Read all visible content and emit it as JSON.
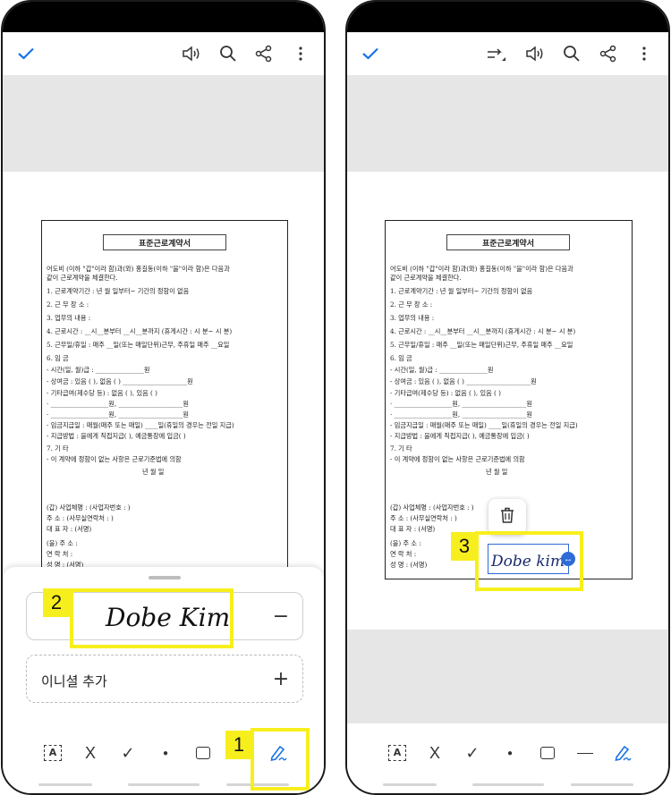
{
  "left_screen": {
    "toolbar": {
      "done_icon": "check-icon",
      "read_aloud_icon": "speaker-icon",
      "search_icon": "search-icon",
      "share_icon": "share-icon",
      "more_icon": "more-vertical-icon"
    },
    "signature_panel": {
      "signature_text": "Dobe Kim",
      "remove_symbol": "−",
      "add_initial_label": "이니셜 추가",
      "add_symbol": "+"
    },
    "bottom_tools": {
      "text_box_glyph": "A",
      "cross_glyph": "X",
      "check_glyph": "✓",
      "dot_glyph": "●",
      "sign_tool_icon": "pen-signature-icon"
    },
    "badges": {
      "one": "1",
      "two": "2"
    }
  },
  "right_screen": {
    "toolbar": {
      "done_icon": "check-icon",
      "reflow_icon": "reflow-icon",
      "read_aloud_icon": "speaker-icon",
      "search_icon": "search-icon",
      "share_icon": "share-icon",
      "more_icon": "more-vertical-icon"
    },
    "placed_signature": "Dobe kim",
    "delete_icon": "trash-icon",
    "resize_glyph": "↔",
    "bottom_tools": {
      "text_box_glyph": "A",
      "cross_glyph": "X",
      "check_glyph": "✓",
      "dot_glyph": "●",
      "sign_tool_icon": "pen-signature-icon"
    },
    "badges": {
      "three": "3"
    }
  },
  "contract": {
    "title": "표준근로계약서",
    "lines": [
      "어도비 (이하 \"갑\"이라 함)과(와) 홍길동(이하 \"을\"이라 함)은 다음과",
      "같이 근로계약을 체결한다.",
      "1. 근로계약기간 :      년     월     일부터~ 기간의 정함이 없음",
      "2. 근 무 장 소 :",
      "3. 업무의 내용 :",
      "4. 근로시간 : __시__분부터 __시__분까지 (휴게시간 : 시 분~ 시 분)",
      "5. 근무일/휴일 : 매주 __일(또는 매일단위)근무, 주휴일 매주 __요일",
      "6. 임   금",
      " - 시간(일, 월)급 : _______________원",
      " - 상여금 : 있음 (    ),    없음 (    )  ____________________원",
      " - 기타급여(제수당 등) : 없음 (     ),    있음 (     )",
      "   · __________________원,  ____________________원",
      "   · __________________원,  ____________________원",
      " - 임금지급일 : 매월(매주 또는 매일) ____일(휴일의 경우는 전일 지급)",
      " - 지급방법 : 을에게 직접지급(    ), 예금통장에 입금(    )",
      "7. 기   타",
      " - 이 계약에 정함이 없는 사항은 근로기준법에 의함",
      "년       월       일",
      "(갑) 사업체명 :                      (사업자번호 :                  )",
      "       주    소 :                      (사무실연락처 :                )",
      "       대 표 자 :                          (서명)",
      "(을) 주    소 :",
      "       연 락 처 :",
      "       성    명 :                          (서명)"
    ]
  }
}
